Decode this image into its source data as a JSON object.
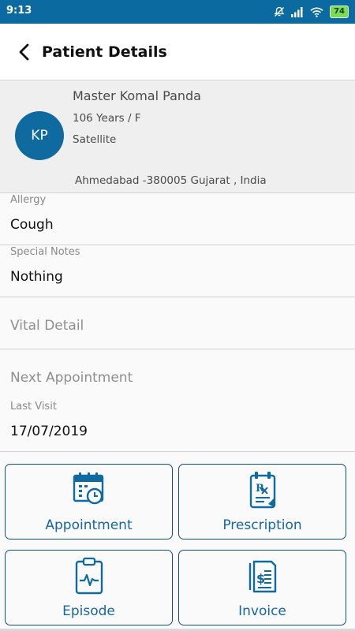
{
  "status_bar": {
    "time": "9:13",
    "battery": "74"
  },
  "header": {
    "title": "Patient Details"
  },
  "patient": {
    "initials": "KP",
    "name": "Master Komal Panda",
    "age_gender": "106 Years / F",
    "location": "Satellite",
    "address": "Ahmedabad -380005 Gujarat , India"
  },
  "fields": {
    "allergy": {
      "label": "Allergy",
      "value": "Cough"
    },
    "special_notes": {
      "label": "Special Notes",
      "value": "Nothing"
    },
    "vital_detail": {
      "placeholder": "Vital Detail"
    },
    "next_appointment": {
      "placeholder": "Next Appointment"
    },
    "last_visit": {
      "label": "Last Visit",
      "value": "17/07/2019"
    }
  },
  "actions": {
    "appointment": "Appointment",
    "prescription": "Prescription",
    "episode": "Episode",
    "invoice": "Invoice"
  },
  "colors": {
    "primary": "#0b6aa0",
    "tile_border": "#0d4f86",
    "tile_text": "#1666a3"
  }
}
